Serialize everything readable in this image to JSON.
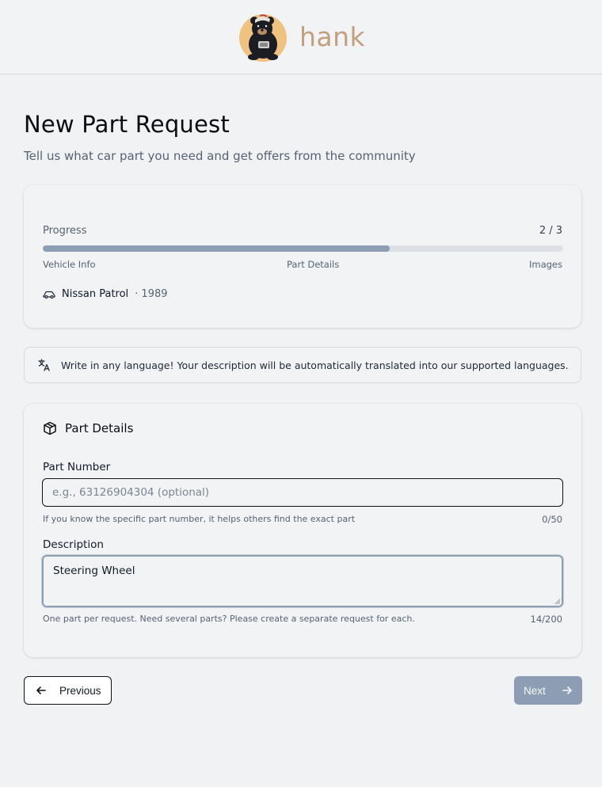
{
  "brand": {
    "name": "hank",
    "logo_icon": "bear-mascot-icon"
  },
  "page": {
    "title": "New Part Request",
    "subtitle": "Tell us what car part you need and get offers from the community"
  },
  "progress": {
    "label": "Progress",
    "count": "2 / 3",
    "fraction": 0.6667,
    "steps": [
      "Vehicle Info",
      "Part Details",
      "Images"
    ]
  },
  "vehicle": {
    "icon": "car-icon",
    "name": "Nissan Patrol",
    "year": "· 1989"
  },
  "notice": {
    "icon": "translate-icon",
    "text": "Write in any language! Your description will be automatically translated into our supported languages."
  },
  "details": {
    "icon": "package-icon",
    "title": "Part Details",
    "part_number": {
      "label": "Part Number",
      "placeholder": "e.g., 63126904304 (optional)",
      "value": "",
      "help": "If you know the specific part number, it helps others find the exact part",
      "counter": "0/50"
    },
    "description": {
      "label": "Description",
      "value": "Steering Wheel",
      "help": "One part per request. Need several parts? Please create a separate request for each.",
      "counter": "14/200"
    }
  },
  "nav": {
    "previous": "Previous",
    "next": "Next"
  },
  "colors": {
    "accent": "#8d9db3",
    "brand_text": "#c2a07e",
    "background": "#f0f2f4"
  }
}
